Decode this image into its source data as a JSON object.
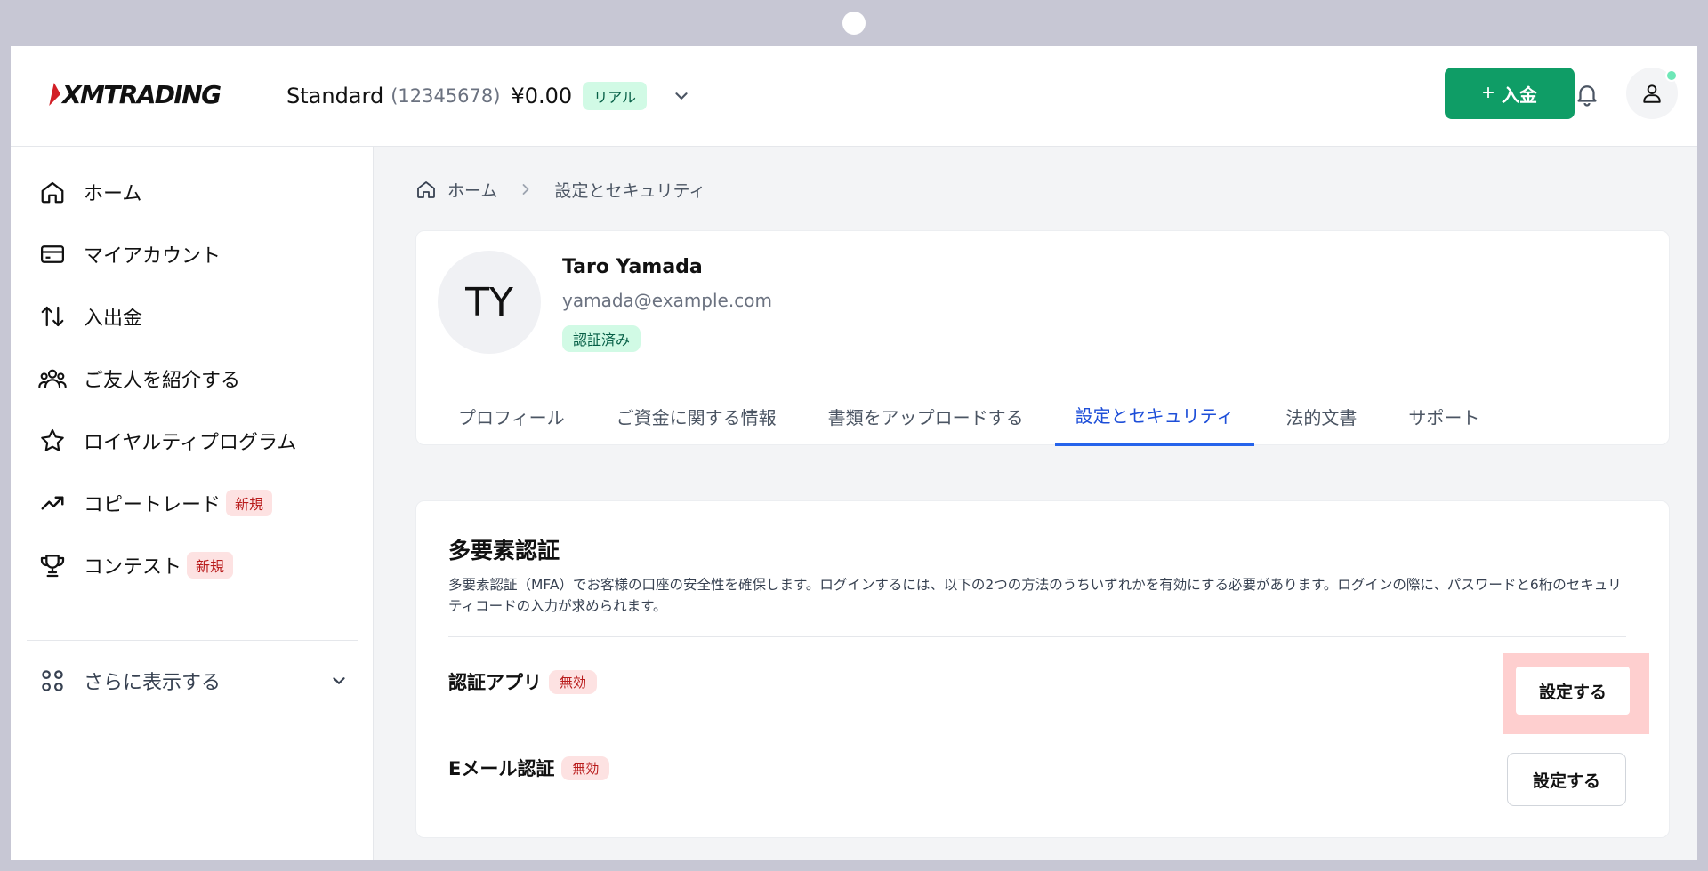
{
  "header": {
    "logo": "XMTRADING",
    "account_type": "Standard",
    "account_number": "(12345678)",
    "balance": "¥0.00",
    "account_mode": "リアル",
    "deposit_label": "入金",
    "deposit_symbol": "+"
  },
  "sidebar": {
    "items": [
      {
        "label": "ホーム"
      },
      {
        "label": "マイアカウント"
      },
      {
        "label": "入出金"
      },
      {
        "label": "ご友人を紹介する"
      },
      {
        "label": "ロイヤルティプログラム"
      },
      {
        "label": "コピートレード",
        "badge": "新規"
      },
      {
        "label": "コンテスト",
        "badge": "新規"
      }
    ],
    "more_label": "さらに表示する"
  },
  "breadcrumb": {
    "home": "ホーム",
    "current": "設定とセキュリティ"
  },
  "profile": {
    "initials": "TY",
    "name": "Taro Yamada",
    "email": "yamada@example.com",
    "status": "認証済み",
    "tabs": [
      {
        "label": "プロフィール"
      },
      {
        "label": "ご資金に関する情報"
      },
      {
        "label": "書類をアップロードする"
      },
      {
        "label": "設定とセキュリティ"
      },
      {
        "label": "法的文書"
      },
      {
        "label": "サポート"
      }
    ],
    "active_tab": "設定とセキュリティ"
  },
  "mfa": {
    "title": "多要素認証",
    "description": "多要素認証（MFA）でお客様の口座の安全性を確保します。ログインするには、以下の2つの方法のうちいずれかを有効にする必要があります。ログインの際に、パスワードと6桁のセキュリティコードの入力が求められます。",
    "methods": [
      {
        "label": "認証アプリ",
        "status": "無効",
        "button": "設定する"
      },
      {
        "label": "Eメール認証",
        "status": "無効",
        "button": "設定する"
      }
    ]
  },
  "colors": {
    "accent_green": "#0f9d66",
    "active_tab_blue": "#2563eb",
    "badge_red_bg": "#fde2e2",
    "badge_red_text": "#b91c1c",
    "highlight": "#fecaca"
  },
  "icons": [
    "home-icon",
    "card-icon",
    "transfer-icon",
    "users-icon",
    "star-icon",
    "trend-icon",
    "trophy-icon",
    "grid-icon",
    "bell-icon",
    "user-icon",
    "chevron-down-icon",
    "chevron-right-icon"
  ]
}
